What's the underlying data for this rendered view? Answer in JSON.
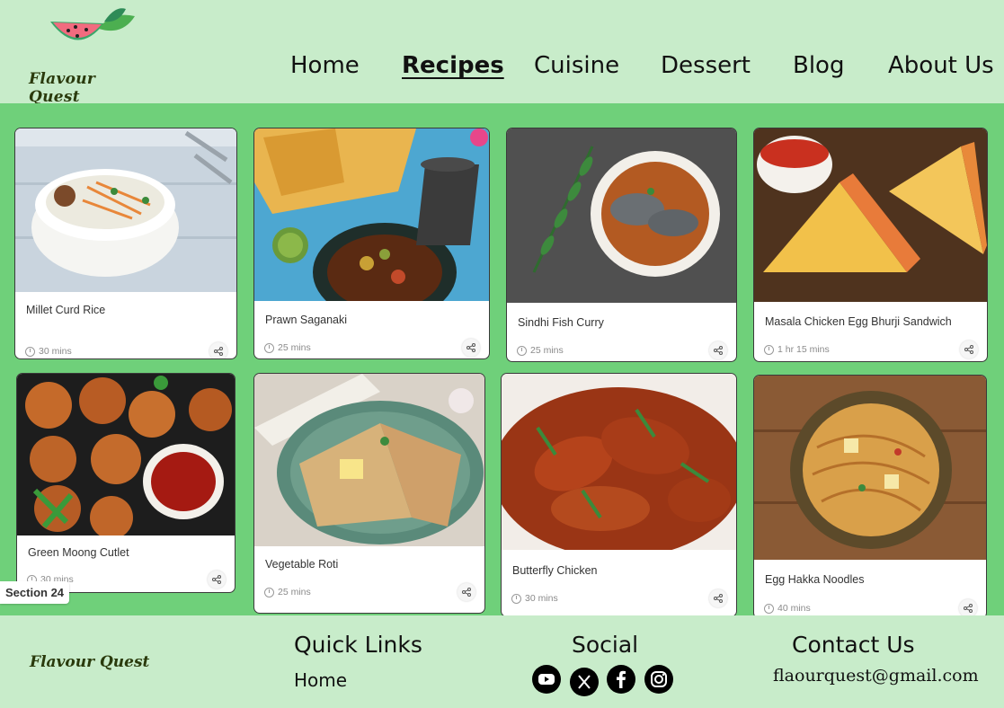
{
  "brand": {
    "name": "Flavour Quest"
  },
  "nav": {
    "items": [
      {
        "label": "Home"
      },
      {
        "label": "Recipes",
        "active": true
      },
      {
        "label": "Cuisine"
      },
      {
        "label": "Dessert"
      },
      {
        "label": "Blog"
      },
      {
        "label": "About Us"
      }
    ]
  },
  "recipes": [
    {
      "title": "Millet Curd Rice",
      "time": "30 mins"
    },
    {
      "title": "Prawn Saganaki",
      "time": "25 mins"
    },
    {
      "title": "Sindhi Fish Curry",
      "time": "25 mins"
    },
    {
      "title": "Masala Chicken Egg Bhurji Sandwich",
      "time": "1 hr 15 mins"
    },
    {
      "title": "Green Moong Cutlet",
      "time": "30 mins"
    },
    {
      "title": "Vegetable Roti",
      "time": "25 mins"
    },
    {
      "title": "Butterfly Chicken",
      "time": "30 mins"
    },
    {
      "title": "Egg Hakka Noodles",
      "time": "40 mins"
    }
  ],
  "section_tag": "Section 24",
  "footer": {
    "brand": "Flavour Quest",
    "quick_links": {
      "heading": "Quick Links",
      "items": [
        "Home"
      ]
    },
    "social": {
      "heading": "Social",
      "icons": [
        "youtube-icon",
        "x-icon",
        "facebook-icon",
        "instagram-icon"
      ]
    },
    "contact": {
      "heading": "Contact Us",
      "email": "flaourquest@gmail.com"
    }
  },
  "colors": {
    "header_bg": "#c8ecca",
    "main_bg": "#6fd07a",
    "footer_bg": "#c8ecca"
  }
}
